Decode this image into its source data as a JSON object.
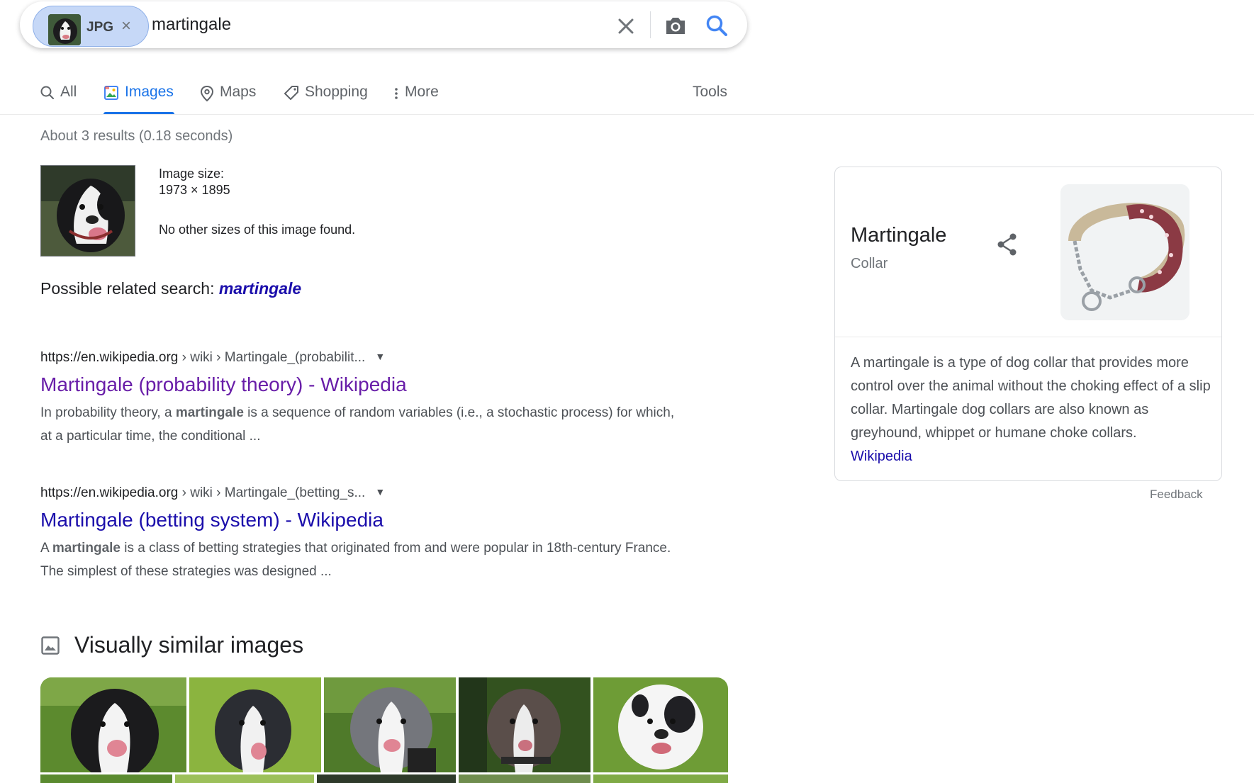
{
  "search": {
    "chip_label": "JPG",
    "chip_remove": "×",
    "query": "martingale"
  },
  "tabs": [
    {
      "label": "All",
      "icon": "search-icon"
    },
    {
      "label": "Images",
      "icon": "image-icon",
      "active": true
    },
    {
      "label": "Maps",
      "icon": "map-pin-icon"
    },
    {
      "label": "Shopping",
      "icon": "tag-icon"
    },
    {
      "label": "More",
      "icon": "more-vert-icon"
    }
  ],
  "tools_label": "Tools",
  "stats": "About 3 results (0.18 seconds)",
  "image_info": {
    "size_label": "Image size:",
    "size_value": "1973 × 1895",
    "no_sizes": "No other sizes of this image found."
  },
  "related": {
    "prefix": "Possible related search: ",
    "term": "martingale"
  },
  "results": [
    {
      "domain": "https://en.wikipedia.org",
      "path": " › wiki › Martingale_(probabilit...",
      "title": "Martingale (probability theory) - Wikipedia",
      "snippet_before": "In probability theory, a ",
      "snippet_bold": "martingale",
      "snippet_after": " is a sequence of random variables (i.e., a stochastic process) for which, at a particular time, the conditional ..."
    },
    {
      "domain": "https://en.wikipedia.org",
      "path": " › wiki › Martingale_(betting_s...",
      "title": "Martingale (betting system) - Wikipedia",
      "snippet_before": "A ",
      "snippet_bold": "martingale",
      "snippet_after": " is a class of betting strategies that originated from and were popular in 18th-century France. The simplest of these strategies was designed ..."
    }
  ],
  "similar": {
    "title": "Visually similar images",
    "icon": "image-outline-icon"
  },
  "knowledge_panel": {
    "title": "Martingale",
    "subtitle": "Collar",
    "description": "A martingale is a type of dog collar that provides more control over the animal without the choking effect of a slip collar. Martingale dog collars are also known as greyhound, whippet or humane choke collars.",
    "source_link": "Wikipedia"
  },
  "feedback": "Feedback",
  "colors": {
    "accent": "#1a73e8",
    "link": "#1a0dab",
    "visited": "#681da8",
    "chip_bg": "#c6d8f7"
  }
}
